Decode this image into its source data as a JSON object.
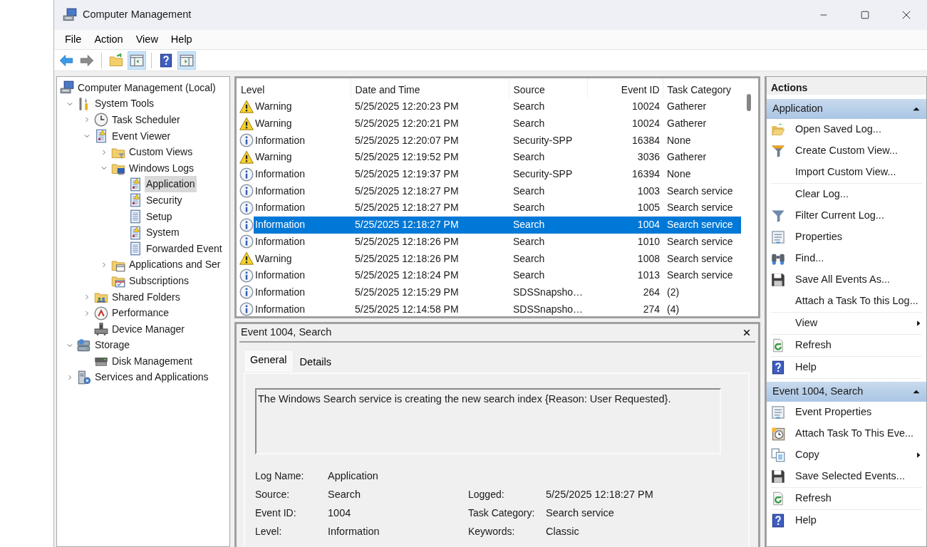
{
  "window": {
    "title": "Computer Management"
  },
  "menu": [
    "File",
    "Action",
    "View",
    "Help"
  ],
  "toolbar": [
    [
      {
        "kind": "back",
        "pressed": false
      },
      {
        "kind": "forward",
        "pressed": false
      }
    ],
    [
      {
        "kind": "up",
        "pressed": false
      },
      {
        "kind": "tree-pane",
        "pressed": true
      }
    ],
    [
      {
        "kind": "help",
        "pressed": false
      },
      {
        "kind": "action-pane",
        "pressed": true
      }
    ]
  ],
  "tree": {
    "label": "Computer Management (Local)",
    "kind": "computer",
    "selected": false,
    "children": [
      {
        "label": "System Tools",
        "kind": "tools",
        "selected": false,
        "expanded": true,
        "children": [
          {
            "label": "Task Scheduler",
            "kind": "clock",
            "selected": false,
            "expanded": false
          },
          {
            "label": "Event Viewer",
            "kind": "eventlog",
            "selected": false,
            "expanded": true,
            "children": [
              {
                "label": "Custom Views",
                "kind": "folder-filter",
                "selected": false,
                "expanded": false
              },
              {
                "label": "Windows Logs",
                "kind": "folder-monitor",
                "selected": false,
                "expanded": true,
                "children": [
                  {
                    "label": "Application",
                    "kind": "log-warning",
                    "selected": true
                  },
                  {
                    "label": "Security",
                    "kind": "log-warning",
                    "selected": false
                  },
                  {
                    "label": "Setup",
                    "kind": "log",
                    "selected": false
                  },
                  {
                    "label": "System",
                    "kind": "log-warning",
                    "selected": false
                  },
                  {
                    "label": "Forwarded Event",
                    "kind": "log",
                    "selected": false
                  }
                ]
              },
              {
                "label": "Applications and Ser",
                "kind": "folder-window",
                "selected": false,
                "expanded": false
              },
              {
                "label": "Subscriptions",
                "kind": "folder-calendar",
                "selected": false
              }
            ]
          },
          {
            "label": "Shared Folders",
            "kind": "shared",
            "selected": false,
            "expanded": false
          },
          {
            "label": "Performance",
            "kind": "performance",
            "selected": false,
            "expanded": false
          },
          {
            "label": "Device Manager",
            "kind": "device",
            "selected": false
          }
        ]
      },
      {
        "label": "Storage",
        "kind": "storage",
        "selected": false,
        "expanded": true,
        "children": [
          {
            "label": "Disk Management",
            "kind": "disk",
            "selected": false
          }
        ]
      },
      {
        "label": "Services and Applications",
        "kind": "services",
        "selected": false,
        "expanded": false
      }
    ]
  },
  "events": {
    "columns": [
      "Level",
      "Date and Time",
      "Source",
      "Event ID",
      "Task Category"
    ],
    "rows": [
      {
        "kind": "warning",
        "cells": [
          "Warning",
          "5/25/2025 12:20:23 PM",
          "Search",
          "10024",
          "Gatherer"
        ],
        "selected": false
      },
      {
        "kind": "warning",
        "cells": [
          "Warning",
          "5/25/2025 12:20:21 PM",
          "Search",
          "10024",
          "Gatherer"
        ],
        "selected": false
      },
      {
        "kind": "information",
        "cells": [
          "Information",
          "5/25/2025 12:20:07 PM",
          "Security-SPP",
          "16384",
          "None"
        ],
        "selected": false
      },
      {
        "kind": "warning",
        "cells": [
          "Warning",
          "5/25/2025 12:19:52 PM",
          "Search",
          "3036",
          "Gatherer"
        ],
        "selected": false
      },
      {
        "kind": "information",
        "cells": [
          "Information",
          "5/25/2025 12:19:37 PM",
          "Security-SPP",
          "16394",
          "None"
        ],
        "selected": false
      },
      {
        "kind": "information",
        "cells": [
          "Information",
          "5/25/2025 12:18:27 PM",
          "Search",
          "1003",
          "Search service"
        ],
        "selected": false
      },
      {
        "kind": "information",
        "cells": [
          "Information",
          "5/25/2025 12:18:27 PM",
          "Search",
          "1005",
          "Search service"
        ],
        "selected": false
      },
      {
        "kind": "information",
        "cells": [
          "Information",
          "5/25/2025 12:18:27 PM",
          "Search",
          "1004",
          "Search service"
        ],
        "selected": true
      },
      {
        "kind": "information",
        "cells": [
          "Information",
          "5/25/2025 12:18:26 PM",
          "Search",
          "1010",
          "Search service"
        ],
        "selected": false
      },
      {
        "kind": "warning",
        "cells": [
          "Warning",
          "5/25/2025 12:18:26 PM",
          "Search",
          "1008",
          "Search service"
        ],
        "selected": false
      },
      {
        "kind": "information",
        "cells": [
          "Information",
          "5/25/2025 12:18:24 PM",
          "Search",
          "1013",
          "Search service"
        ],
        "selected": false
      },
      {
        "kind": "information",
        "cells": [
          "Information",
          "5/25/2025 12:15:29 PM",
          "SDSSnapsho…",
          "264",
          "(2)"
        ],
        "selected": false
      },
      {
        "kind": "information",
        "cells": [
          "Information",
          "5/25/2025 12:14:58 PM",
          "SDSSnapsho…",
          "274",
          "(4)"
        ],
        "selected": false
      }
    ]
  },
  "detail": {
    "title": "Event 1004, Search",
    "tabs": [
      {
        "label": "General",
        "selected": true
      },
      {
        "label": "Details",
        "selected": false
      }
    ],
    "message": "The Windows Search service is creating the new search index {Reason: User Requested}.",
    "fields": [
      [
        {
          "label": "Log Name:",
          "value": "Application"
        }
      ],
      [
        {
          "label": "Source:",
          "value": "Search"
        },
        {
          "label": "Logged:",
          "value": "5/25/2025 12:18:27 PM"
        }
      ],
      [
        {
          "label": "Event ID:",
          "value": "1004"
        },
        {
          "label": "Task Category:",
          "value": "Search service"
        }
      ],
      [
        {
          "label": "Level:",
          "value": "Information"
        },
        {
          "label": "Keywords:",
          "value": "Classic"
        }
      ]
    ]
  },
  "actions": {
    "title": "Actions",
    "sections": [
      {
        "title": "Application",
        "expanded": true,
        "groups": [
          [
            {
              "label": "Open Saved Log...",
              "kind": "open",
              "submenu": false
            },
            {
              "label": "Create Custom View...",
              "kind": "funnel",
              "submenu": false
            },
            {
              "label": "Import Custom View...",
              "kind": "plain",
              "submenu": false
            }
          ],
          [
            {
              "label": "Clear Log...",
              "kind": "plain",
              "submenu": false
            },
            {
              "label": "Filter Current Log...",
              "kind": "filter",
              "submenu": false
            },
            {
              "label": "Properties",
              "kind": "properties",
              "submenu": false
            },
            {
              "label": "Find...",
              "kind": "find",
              "submenu": false
            },
            {
              "label": "Save All Events As...",
              "kind": "save",
              "submenu": false
            },
            {
              "label": "Attach a Task To this Log...",
              "kind": "plain",
              "submenu": false
            }
          ],
          [
            {
              "label": "View",
              "kind": "plain",
              "submenu": true
            }
          ],
          [
            {
              "label": "Refresh",
              "kind": "refresh",
              "submenu": false
            }
          ],
          [
            {
              "label": "Help",
              "kind": "help",
              "submenu": false
            }
          ]
        ]
      },
      {
        "title": "Event 1004, Search",
        "expanded": true,
        "groups": [
          [
            {
              "label": "Event Properties",
              "kind": "properties",
              "submenu": false
            },
            {
              "label": "Attach Task To This Eve...",
              "kind": "attach-task",
              "submenu": false
            },
            {
              "label": "Copy",
              "kind": "copy",
              "submenu": true
            },
            {
              "label": "Save Selected Events...",
              "kind": "save",
              "submenu": false
            }
          ],
          [
            {
              "label": "Refresh",
              "kind": "refresh",
              "submenu": false
            }
          ],
          [
            {
              "label": "Help",
              "kind": "help",
              "submenu": false
            }
          ]
        ]
      }
    ]
  }
}
